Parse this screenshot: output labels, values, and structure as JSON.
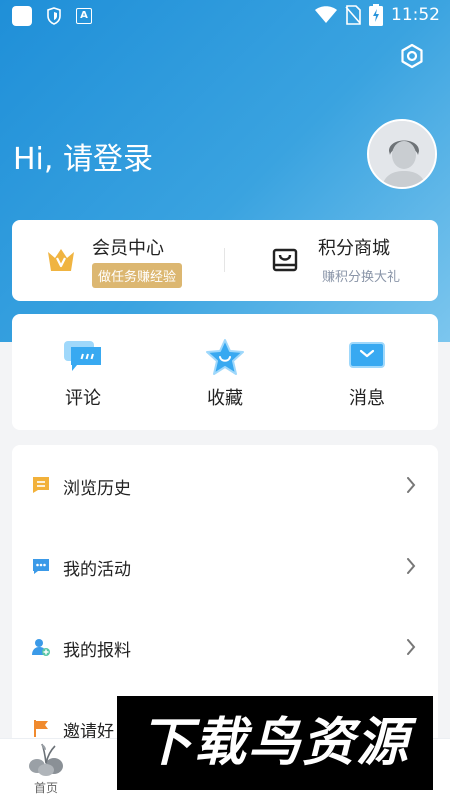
{
  "status_bar": {
    "time": "11:52",
    "icons": [
      "app-icon",
      "shield-icon",
      "a-icon",
      "wifi-icon",
      "no-sim-icon",
      "battery-charging-icon"
    ]
  },
  "header": {
    "greeting": "Hi, 请登录",
    "colors": {
      "gradient_start": "#1f8fd8",
      "gradient_end": "#7cc6ee"
    }
  },
  "member_card": {
    "member": {
      "title": "会员中心",
      "badge": "做任务赚经验",
      "icon": "crown-icon"
    },
    "shop": {
      "title": "积分商城",
      "subtitle": "赚积分换大礼",
      "icon": "shopping-bag-icon"
    }
  },
  "actions": [
    {
      "label": "评论",
      "icon": "comment-icon"
    },
    {
      "label": "收藏",
      "icon": "star-icon"
    },
    {
      "label": "消息",
      "icon": "message-icon"
    }
  ],
  "list": [
    {
      "label": "浏览历史",
      "icon": "history-icon"
    },
    {
      "label": "我的活动",
      "icon": "activity-icon"
    },
    {
      "label": "我的报料",
      "icon": "report-icon"
    },
    {
      "label": "邀请好",
      "icon": "flag-icon"
    }
  ],
  "tabbar": {
    "home_label": "首页"
  },
  "watermark": "下载鸟资源"
}
